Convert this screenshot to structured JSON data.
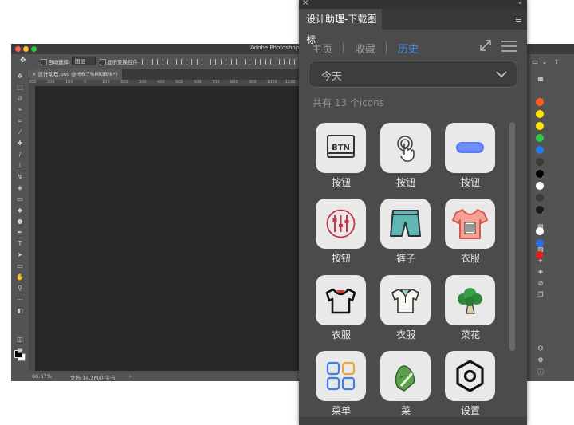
{
  "photoshop": {
    "app_title": "Adobe Photoshop",
    "options": {
      "auto_select_label": "自动选择:",
      "layer_select": "图层",
      "show_transform_label": "显示变换控件"
    },
    "doc_tab": "设计助理.psd @ 66.7%(RGB/8*)",
    "ruler_ticks": [
      "300",
      "200",
      "100",
      "0",
      "100",
      "200",
      "300",
      "400",
      "500",
      "600",
      "700",
      "800",
      "900",
      "1000",
      "1100",
      "1200",
      "1300",
      "1400"
    ],
    "status": {
      "zoom": "66.67%",
      "doc_info": "文档:14.2M/0 字节"
    },
    "swatch_colors": [
      "#ff5a1f",
      "#ffe600",
      "#ffe600",
      "#2ec84a",
      "#2478f0",
      "#3a3a3a",
      "#000000",
      "#ffffff",
      "#3a3a3a",
      "#1b1b1b",
      "#ffffff",
      "#2c6ee8",
      "#e02020"
    ]
  },
  "panel": {
    "title": "设计助理-下载图标",
    "nav": {
      "home": "主页",
      "favorites": "收藏",
      "history": "历史"
    },
    "dropdown_value": "今天",
    "count_text": "共有 13 个icons",
    "icons": [
      {
        "label": "按钮",
        "icon": "btn-text-icon"
      },
      {
        "label": "按钮",
        "icon": "tap-hand-icon"
      },
      {
        "label": "按钮",
        "icon": "blue-pill-button-icon"
      },
      {
        "label": "按钮",
        "icon": "mixer-button-icon"
      },
      {
        "label": "裤子",
        "icon": "shorts-icon"
      },
      {
        "label": "衣服",
        "icon": "tshirt-icon"
      },
      {
        "label": "衣服",
        "icon": "black-tshirt-icon"
      },
      {
        "label": "衣服",
        "icon": "polo-shirt-icon"
      },
      {
        "label": "菜花",
        "icon": "broccoli-icon"
      },
      {
        "label": "菜单",
        "icon": "menu-grid-icon"
      },
      {
        "label": "菜",
        "icon": "bok-choy-icon"
      },
      {
        "label": "设置",
        "icon": "settings-hex-icon"
      }
    ],
    "accent": "#3f8cf3"
  }
}
